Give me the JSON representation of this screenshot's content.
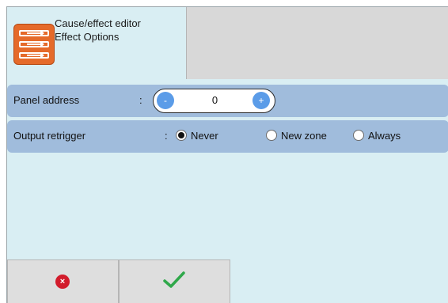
{
  "header": {
    "title": "Cause/effect editor",
    "subtitle": "Effect Options",
    "icon": "cause-effect-editor-icon",
    "accent_color": "#e56a2a"
  },
  "panel_address": {
    "label": "Panel address",
    "colon": ":",
    "value": "0",
    "decrement_symbol": "-",
    "increment_symbol": "+"
  },
  "output_retrigger": {
    "label": "Output retrigger",
    "colon": ":",
    "options": [
      {
        "label": "Never",
        "selected": true
      },
      {
        "label": "New zone",
        "selected": false
      },
      {
        "label": "Always",
        "selected": false
      }
    ]
  },
  "footer": {
    "cancel_icon": "cancel-icon",
    "cancel_symbol": "×",
    "confirm_icon": "checkmark-icon",
    "cancel_color": "#d21c2c",
    "confirm_color": "#2fa84a"
  },
  "colors": {
    "background": "#d9eef3",
    "row": "#a0bcdc",
    "stepper_button": "#5b9ce8"
  }
}
